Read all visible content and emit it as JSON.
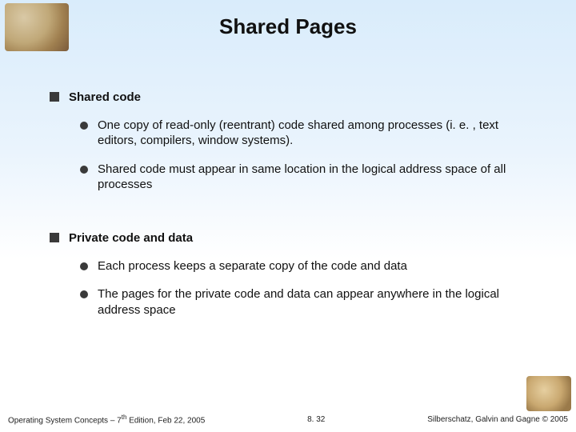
{
  "slide": {
    "title": "Shared Pages",
    "section1": {
      "heading": "Shared code",
      "bullets": [
        "One copy of read-only (reentrant) code shared among processes (i. e. , text editors, compilers, window systems).",
        "Shared code must appear in same location in the logical address space of all processes"
      ]
    },
    "section2": {
      "heading": "Private code and data",
      "bullets": [
        "Each process keeps a separate copy of the code and data",
        "The pages for the private code and data can appear anywhere in the logical address space"
      ]
    }
  },
  "footer": {
    "left_pre": "Operating System Concepts – 7",
    "left_sup": "th",
    "left_post": " Edition, Feb 22, 2005",
    "center": "8. 32",
    "right": "Silberschatz, Galvin and Gagne © 2005"
  }
}
